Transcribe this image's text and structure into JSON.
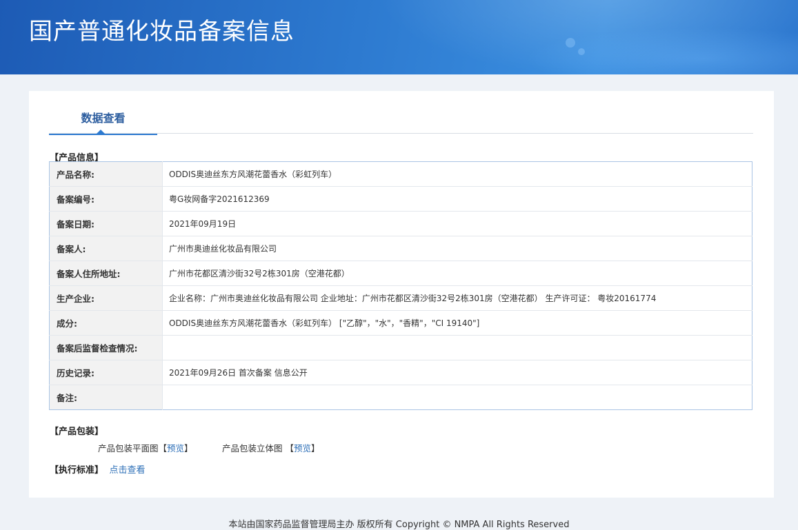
{
  "header": {
    "title": "国产普通化妆品备案信息"
  },
  "tabs": [
    {
      "label": "数据查看"
    }
  ],
  "product_section": {
    "title": "【产品信息】",
    "rows": [
      {
        "label": "产品名称:",
        "value": "ODDIS奥迪丝东方风潮花蕾香水（彩虹列车）"
      },
      {
        "label": "备案编号:",
        "value": "粤G妆网备字2021612369"
      },
      {
        "label": "备案日期:",
        "value": "2021年09月19日"
      },
      {
        "label": "备案人:",
        "value": "广州市奥迪丝化妆品有限公司"
      },
      {
        "label": "备案人住所地址:",
        "value": "广州市花都区清沙街32号2栋301房（空港花都）"
      },
      {
        "label": "生产企业:",
        "value": "企业名称：广州市奥迪丝化妆品有限公司 企业地址：广州市花都区清沙街32号2栋301房（空港花都） 生产许可证： 粤妆20161774"
      },
      {
        "label": "成分:",
        "value": "ODDIS奥迪丝东方风潮花蕾香水（彩虹列车） [\"乙醇\"，\"水\"，\"香精\"，\"CI 19140\"]"
      },
      {
        "label": "备案后监督检查情况:",
        "value": ""
      },
      {
        "label": "历史记录:",
        "value": "2021年09月26日 首次备案 信息公开"
      },
      {
        "label": "备注:",
        "value": ""
      }
    ]
  },
  "package_section": {
    "title": "【产品包装】",
    "flat_label": "产品包装平面图",
    "stereo_label": "产品包装立体图",
    "bracket_open": "【",
    "bracket_close": "】",
    "preview_link": "预览"
  },
  "standard_section": {
    "title": "【执行标准】",
    "link": "点击查看"
  },
  "footer": {
    "text": "本站由国家药品监督管理局主办 版权所有 Copyright © NMPA All Rights Reserved"
  },
  "colors": {
    "banner": "#2d7ad0",
    "link": "#2d6fb7",
    "tab_text": "#2b5c9e",
    "table_border": "#a9c4e4"
  }
}
